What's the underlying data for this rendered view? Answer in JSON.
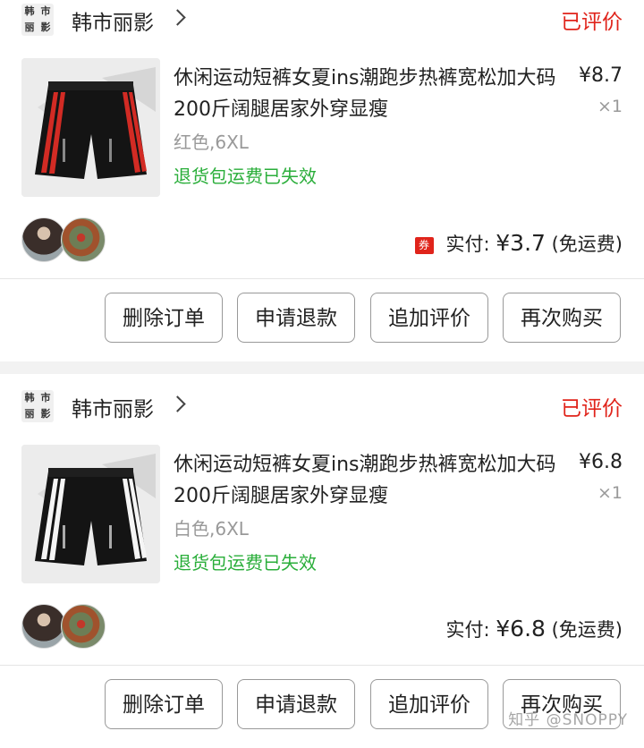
{
  "orders": [
    {
      "shop": {
        "logo_chars": [
          "韩",
          "市",
          "丽",
          "影"
        ],
        "name": "韩市丽影"
      },
      "status": "已评价",
      "product": {
        "title": "休闲运动短裤女夏ins潮跑步热裤宽松加大码200斤阔腿居家外穿显瘦",
        "price": "¥8.7",
        "quantity": "×1",
        "sku": "红色,6XL",
        "return_note": "退货包运费已失效",
        "stripe_color": "#d22b24"
      },
      "payment": {
        "coupon_icon": "券",
        "label": "实付: ",
        "amount": "¥3.7",
        "shipping": " (免运费)"
      },
      "buttons": [
        "删除订单",
        "申请退款",
        "追加评价",
        "再次购买"
      ]
    },
    {
      "shop": {
        "logo_chars": [
          "韩",
          "市",
          "丽",
          "影"
        ],
        "name": "韩市丽影"
      },
      "status": "已评价",
      "product": {
        "title": "休闲运动短裤女夏ins潮跑步热裤宽松加大码200斤阔腿居家外穿显瘦",
        "price": "¥6.8",
        "quantity": "×1",
        "sku": "白色,6XL",
        "return_note": "退货包运费已失效",
        "stripe_color": "#f5f5f5"
      },
      "payment": {
        "label": "实付: ",
        "amount": "¥6.8",
        "shipping": " (免运费)"
      },
      "buttons": [
        "删除订单",
        "申请退款",
        "追加评价",
        "再次购买"
      ]
    }
  ],
  "watermark": "知乎 @SNOPPY"
}
